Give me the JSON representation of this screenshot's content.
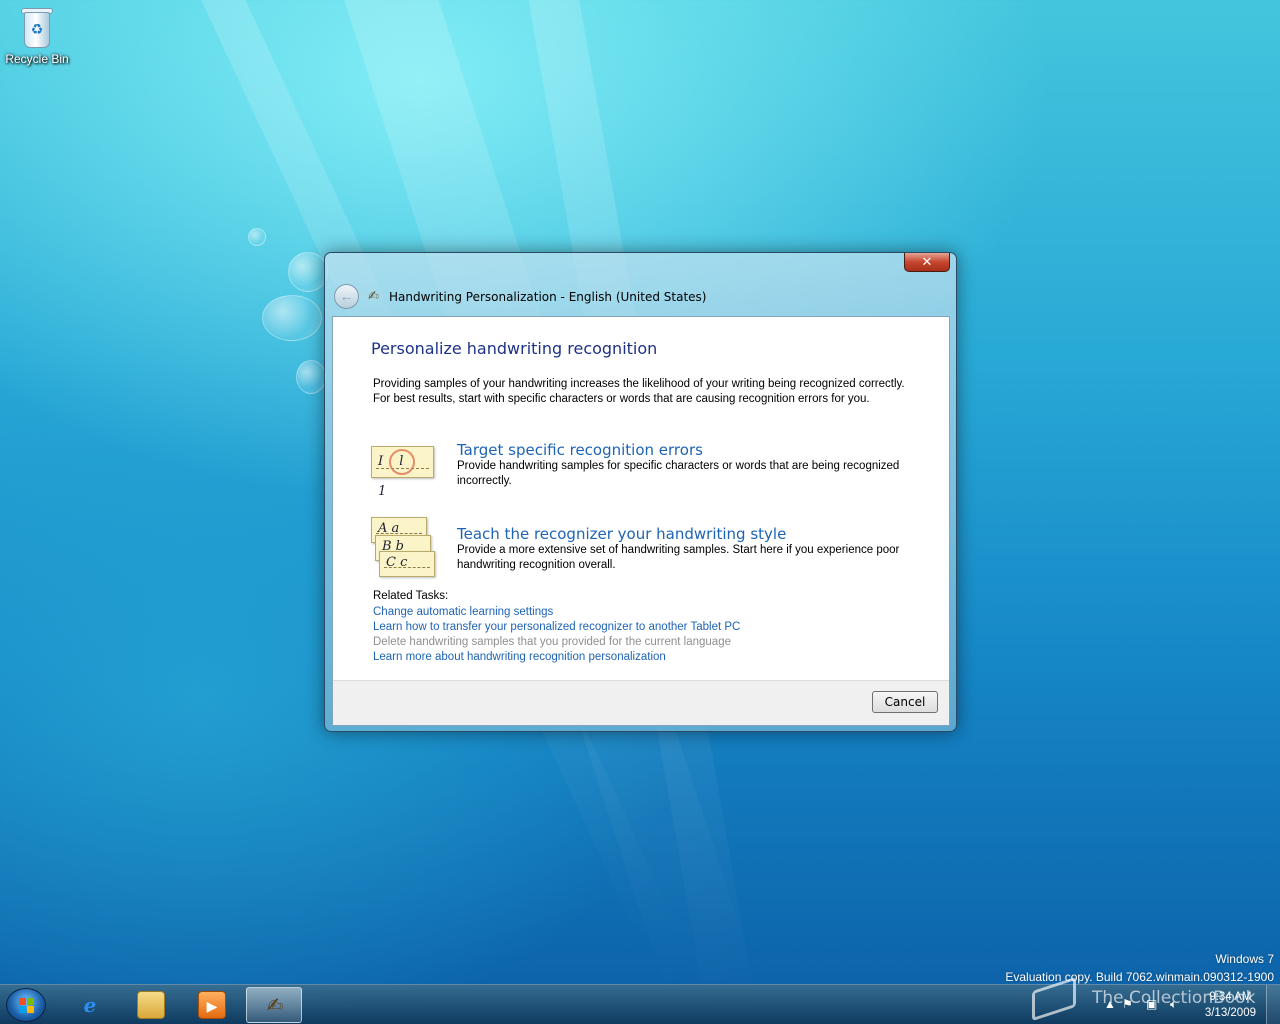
{
  "desktop": {
    "icons": [
      {
        "label": "Recycle Bin",
        "icon": "recycle-bin-icon"
      }
    ],
    "watermark": {
      "line1": "Windows 7",
      "line2": "Evaluation copy. Build 7062.winmain.090312-1900"
    },
    "brand_overlay": "The CollectionBook"
  },
  "dialog": {
    "title": "Handwriting Personalization - English (United States)",
    "close_label": "✕",
    "heading": "Personalize handwriting recognition",
    "intro": "Providing samples of your handwriting increases the likelihood of your writing being recognized correctly. For best results, start with specific characters or words that are causing recognition errors for you.",
    "options": [
      {
        "title": "Target specific recognition errors",
        "description": "Provide handwriting samples for specific characters or words that are being recognized incorrectly.",
        "card_text": "I l 1"
      },
      {
        "title": "Teach the recognizer your handwriting style",
        "description": "Provide a more extensive set of handwriting samples. Start here if you experience poor handwriting recognition overall.",
        "card_texts": [
          "A a",
          "B b",
          "C c"
        ]
      }
    ],
    "related_tasks_label": "Related Tasks:",
    "related_tasks": [
      {
        "label": "Change automatic learning settings",
        "enabled": true
      },
      {
        "label": "Learn how to transfer your personalized recognizer to another Tablet PC",
        "enabled": true
      },
      {
        "label": "Delete handwriting samples that you provided for the current language",
        "enabled": false
      },
      {
        "label": "Learn more about handwriting recognition personalization",
        "enabled": true
      }
    ],
    "cancel_label": "Cancel"
  },
  "taskbar": {
    "pinned": [
      {
        "name": "internet-explorer-icon"
      },
      {
        "name": "windows-explorer-icon"
      },
      {
        "name": "media-player-icon"
      },
      {
        "name": "handwriting-personalization-icon",
        "active": true
      }
    ],
    "clock": {
      "time": "9:34 AM",
      "date": "3/13/2009"
    }
  },
  "colors": {
    "link": "#1e64b4",
    "heading": "#1e3287",
    "disabled": "#8f8f8f"
  }
}
